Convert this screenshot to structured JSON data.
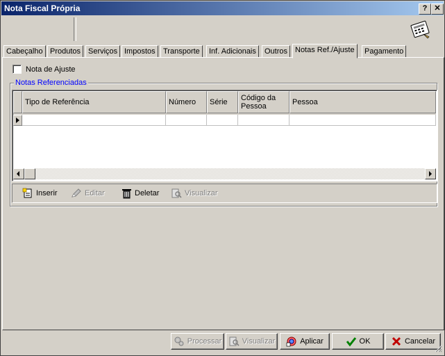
{
  "window": {
    "title": "Nota Fiscal Própria",
    "help_btn": "?",
    "close_btn": "✕"
  },
  "tabs": [
    {
      "label": "Cabeçalho"
    },
    {
      "label": "Produtos"
    },
    {
      "label": "Serviços"
    },
    {
      "label": "Impostos"
    },
    {
      "label": "Transporte"
    },
    {
      "label": "Inf. Adicionais"
    },
    {
      "label": "Outros"
    },
    {
      "label": "Notas Ref./Ajuste"
    },
    {
      "label": "Pagamento"
    }
  ],
  "active_tab": "Notas Ref./Ajuste",
  "panel": {
    "nota_ajuste_label": "Nota de Ajuste",
    "nota_ajuste_checked": false,
    "group_title": "Notas Referenciadas",
    "grid": {
      "columns": [
        {
          "label": "Tipo de Referência"
        },
        {
          "label": "Número"
        },
        {
          "label": "Série"
        },
        {
          "label": "Código da Pessoa"
        },
        {
          "label": "Pessoa"
        }
      ],
      "rows": [
        [
          "",
          "",
          "",
          "",
          ""
        ]
      ]
    },
    "actions": {
      "inserir": "Inserir",
      "editar": "Editar",
      "deletar": "Deletar",
      "visualizar": "Visualizar"
    }
  },
  "footer": {
    "processar": "Processar",
    "visualizar": "Visualizar",
    "aplicar": "Aplicar",
    "ok": "OK",
    "cancelar": "Cancelar"
  },
  "colors": {
    "title_start": "#0a246a",
    "title_end": "#a6caf0",
    "group_label": "#0000ff",
    "face": "#d4d0c8"
  }
}
